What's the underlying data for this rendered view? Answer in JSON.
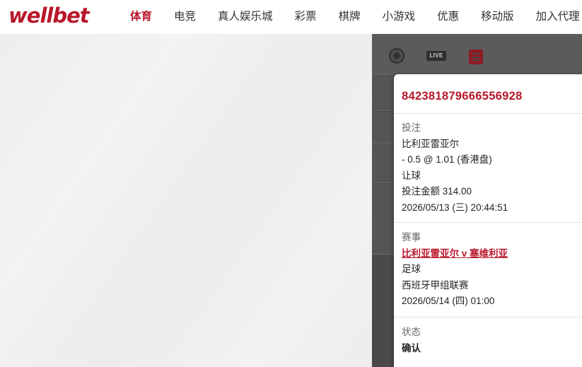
{
  "header": {
    "logo_text": "wellbet",
    "nav": [
      "体育",
      "电竞",
      "真人娱乐城",
      "彩票",
      "棋牌",
      "小游戏",
      "优惠",
      "移动版",
      "加入代理"
    ],
    "active_index": 0
  },
  "side_panel": {
    "tabs": [
      {
        "icon": "soccer-ball-icon"
      },
      {
        "icon": "live-icon",
        "label": "LIVE"
      },
      {
        "icon": "bet-slip-icon"
      }
    ]
  },
  "bet_detail": {
    "bet_id": "842381879666556928",
    "bet": {
      "label": "投注",
      "selection": "比利亚雷亚尔",
      "odds_line": "- 0.5 @ 1.01 (香港盘)",
      "market": "让球",
      "stake": "投注金额 314.00",
      "placed_at": "2026/05/13 (三) 20:44:51"
    },
    "event": {
      "label": "赛事",
      "match": "比利亚雷亚尔 v 塞维利亚",
      "sport": "足球",
      "league": "西班牙甲组联赛",
      "start_time": "2026/05/14 (四) 01:00"
    },
    "status": {
      "label": "状态",
      "value": "确认"
    }
  },
  "colors": {
    "brand": "#b8182b",
    "panel_dark": "#4a4a4a",
    "text": "#222222",
    "muted": "#666666"
  }
}
